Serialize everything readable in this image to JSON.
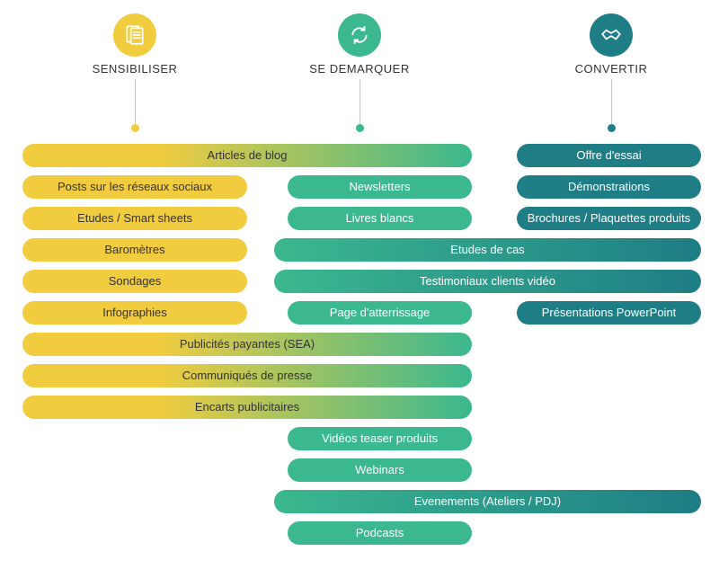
{
  "columns": {
    "c1": "SENSIBILISER",
    "c2": "SE DEMARQUER",
    "c3": "CONVERTIR"
  },
  "pills": {
    "r1a": "Articles de blog",
    "r1b": "Offre d'essai",
    "r2a": "Posts sur les réseaux sociaux",
    "r2b": "Newsletters",
    "r2c": "Démonstrations",
    "r3a": "Etudes / Smart sheets",
    "r3b": "Livres blancs",
    "r3c": "Brochures / Plaquettes produits",
    "r4a": "Baromètres",
    "r4b": "Etudes de cas",
    "r5a": "Sondages",
    "r5b": "Testimoniaux clients vidéo",
    "r6a": "Infographies",
    "r6b": "Page d'atterrissage",
    "r6c": "Présentations PowerPoint",
    "r7": "Publicités payantes (SEA)",
    "r8": "Communiqués de presse",
    "r9": "Encarts publicitaires",
    "r10": "Vidéos teaser produits",
    "r11": "Webinars",
    "r12": "Evenements (Ateliers / PDJ)",
    "r13": "Podcasts"
  },
  "colors": {
    "yellow": "#f1cc3f",
    "green": "#3bb88f",
    "teal": "#1e7d85"
  },
  "diagram": {
    "columns": [
      "SENSIBILISER",
      "SE DEMARQUER",
      "CONVERTIR"
    ],
    "items": [
      {
        "label": "Articles de blog",
        "spans": [
          "SENSIBILISER",
          "SE DEMARQUER"
        ]
      },
      {
        "label": "Offre d'essai",
        "spans": [
          "CONVERTIR"
        ]
      },
      {
        "label": "Posts sur les réseaux sociaux",
        "spans": [
          "SENSIBILISER"
        ]
      },
      {
        "label": "Newsletters",
        "spans": [
          "SE DEMARQUER"
        ]
      },
      {
        "label": "Démonstrations",
        "spans": [
          "CONVERTIR"
        ]
      },
      {
        "label": "Etudes / Smart sheets",
        "spans": [
          "SENSIBILISER"
        ]
      },
      {
        "label": "Livres blancs",
        "spans": [
          "SE DEMARQUER"
        ]
      },
      {
        "label": "Brochures / Plaquettes produits",
        "spans": [
          "CONVERTIR"
        ]
      },
      {
        "label": "Baromètres",
        "spans": [
          "SENSIBILISER"
        ]
      },
      {
        "label": "Etudes de cas",
        "spans": [
          "SE DEMARQUER",
          "CONVERTIR"
        ]
      },
      {
        "label": "Sondages",
        "spans": [
          "SENSIBILISER"
        ]
      },
      {
        "label": "Testimoniaux clients vidéo",
        "spans": [
          "SE DEMARQUER",
          "CONVERTIR"
        ]
      },
      {
        "label": "Infographies",
        "spans": [
          "SENSIBILISER"
        ]
      },
      {
        "label": "Page d'atterrissage",
        "spans": [
          "SE DEMARQUER"
        ]
      },
      {
        "label": "Présentations PowerPoint",
        "spans": [
          "CONVERTIR"
        ]
      },
      {
        "label": "Publicités payantes (SEA)",
        "spans": [
          "SENSIBILISER",
          "SE DEMARQUER"
        ]
      },
      {
        "label": "Communiqués de presse",
        "spans": [
          "SENSIBILISER",
          "SE DEMARQUER"
        ]
      },
      {
        "label": "Encarts publicitaires",
        "spans": [
          "SENSIBILISER",
          "SE DEMARQUER"
        ]
      },
      {
        "label": "Vidéos teaser produits",
        "spans": [
          "SE DEMARQUER"
        ]
      },
      {
        "label": "Webinars",
        "spans": [
          "SE DEMARQUER"
        ]
      },
      {
        "label": "Evenements (Ateliers / PDJ)",
        "spans": [
          "SE DEMARQUER",
          "CONVERTIR"
        ]
      },
      {
        "label": "Podcasts",
        "spans": [
          "SE DEMARQUER"
        ]
      }
    ]
  }
}
